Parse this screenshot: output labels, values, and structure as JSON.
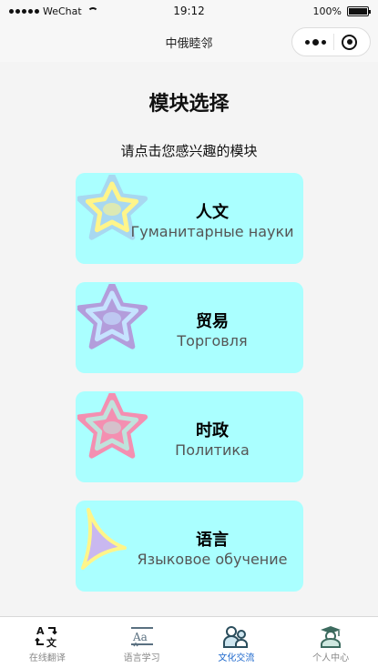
{
  "status_bar": {
    "carrier": "WeChat",
    "time": "19:12",
    "battery": "100%",
    "battery_level": 1.0
  },
  "nav": {
    "title": "中俄睦邻"
  },
  "main": {
    "title": "模块选择",
    "subtitle": "请点击您感兴趣的模块",
    "modules": [
      {
        "title": "人文",
        "subtitle": "Гуманитарные науки",
        "icon": "star-icon",
        "colors": {
          "outer": "#a8d8f0",
          "inner": "#fff58a"
        }
      },
      {
        "title": "贸易",
        "subtitle": "Торговля",
        "icon": "star-icon",
        "colors": {
          "outer": "#b39ddb",
          "inner": "#c5e3ff"
        }
      },
      {
        "title": "时政",
        "subtitle": "Политика",
        "icon": "star-icon",
        "colors": {
          "outer": "#f48fb1",
          "inner": "#bfe3dc"
        }
      },
      {
        "title": "语言",
        "subtitle": "Языковое обучение",
        "icon": "sparkle-icon",
        "colors": {
          "outer": "#fff58a",
          "inner": "#c9b8f0"
        }
      }
    ]
  },
  "tab_bar": {
    "items": [
      {
        "label": "在线翻译",
        "icon": "translate-icon",
        "active": false
      },
      {
        "label": "语言学习",
        "icon": "book-icon",
        "active": false
      },
      {
        "label": "文化交流",
        "icon": "people-icon",
        "active": true
      },
      {
        "label": "个人中心",
        "icon": "graduate-icon",
        "active": false
      }
    ]
  },
  "colors": {
    "card_bg": "#aaffff",
    "active_tab": "#1a66cc"
  }
}
